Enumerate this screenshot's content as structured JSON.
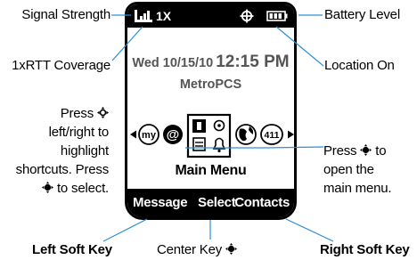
{
  "screen": {
    "network": "1X",
    "date": "Wed 10/15/10",
    "time": "12:15 PM",
    "carrier": "MetroPCS",
    "shortcut_icons": [
      "my-icon",
      "at-icon",
      "main-menu-grid-icon",
      "globe-icon",
      "411-icon"
    ],
    "my_text": "my",
    "info_411_text": "411",
    "at_text": "@",
    "main_menu": "Main Menu",
    "softkeys": {
      "left": "Message",
      "center": "Select",
      "right": "Contacts"
    }
  },
  "callouts": {
    "signal_strength": "Signal Strength",
    "battery_level": "Battery Level",
    "rtt_coverage": "1xRTT Coverage",
    "location_on": "Location On",
    "press_line1": "Press",
    "press_line2": "left/right to",
    "press_line3": "highlight",
    "press_line4": "shortcuts. Press",
    "press_line5": "to select.",
    "open_line1": "Press",
    "open_line1b": "to",
    "open_line2": "open the",
    "open_line3": "main menu.",
    "left_soft_key": "Left Soft Key",
    "center_key": "Center Key",
    "right_soft_key": "Right Soft Key"
  },
  "colors": {
    "screen_bar": "#000000",
    "dim_text": "#555555"
  }
}
